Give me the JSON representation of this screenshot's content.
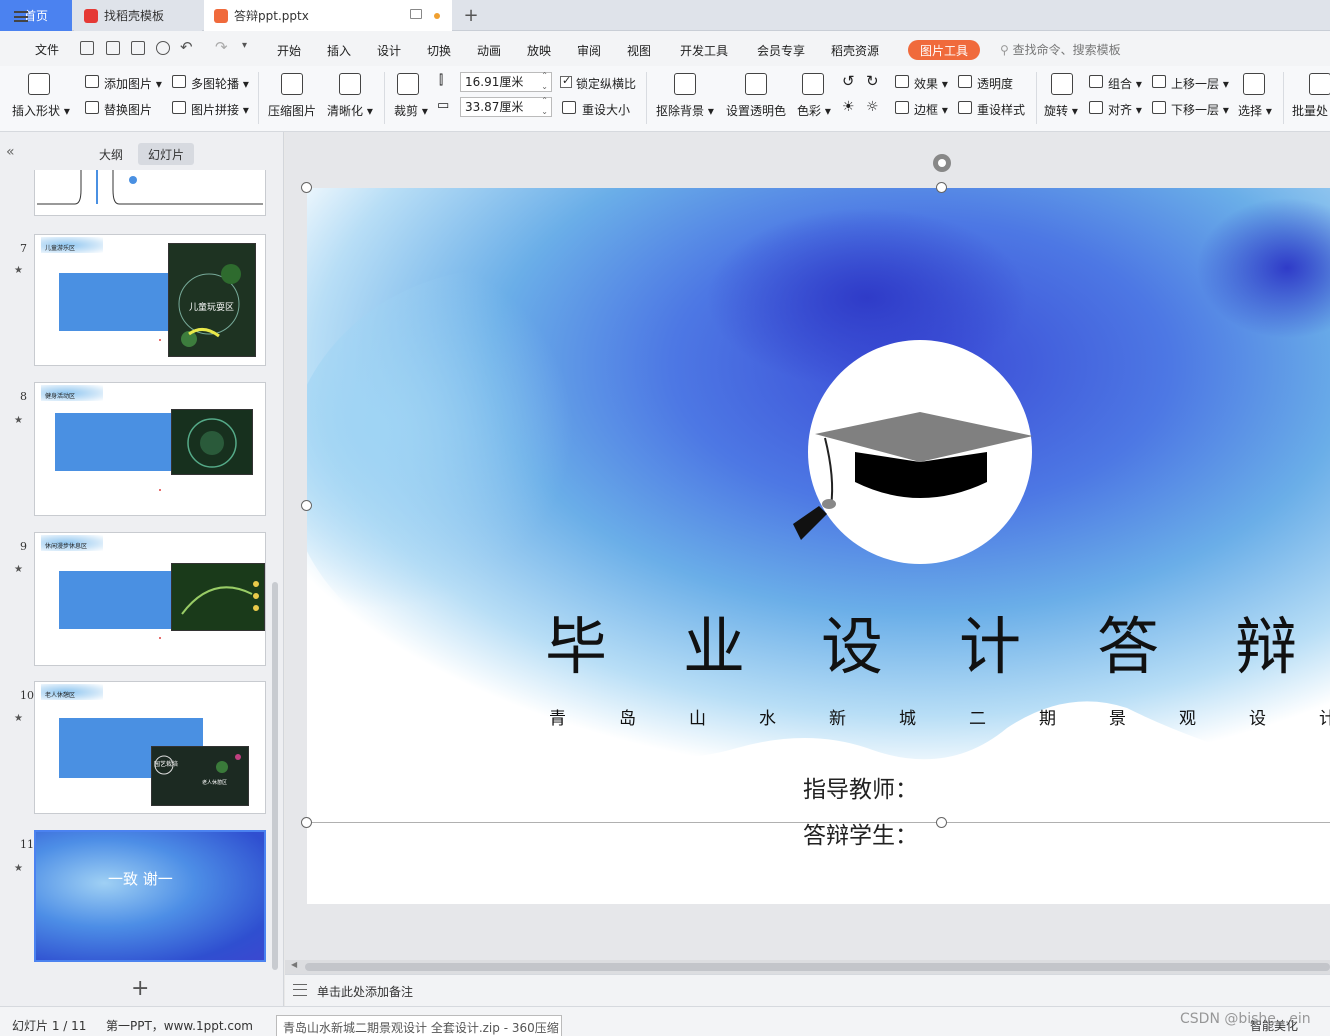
{
  "tabs": {
    "home": "首页",
    "template": "找稻壳模板",
    "file": "答辩ppt.pptx",
    "add": "+"
  },
  "menu": {
    "file": "文件",
    "items": [
      "开始",
      "插入",
      "设计",
      "切换",
      "动画",
      "放映",
      "审阅",
      "视图",
      "开发工具",
      "会员专享",
      "稻壳资源"
    ],
    "picture_tools": "图片工具",
    "search_placeholder": "查找命令、搜索模板"
  },
  "ribbon": {
    "insert_shape": "插入形状",
    "add_picture": "添加图片",
    "replace_picture": "替换图片",
    "multi_carousel": "多图轮播",
    "picture_collage": "图片拼接",
    "compress_picture": "压缩图片",
    "sharpen": "清晰化",
    "crop": "裁剪",
    "height_value": "16.91厘米",
    "width_value": "33.87厘米",
    "lock_aspect": "锁定纵横比",
    "reset_size": "重设大小",
    "remove_bg": "抠除背景",
    "set_transparent": "设置透明色",
    "color": "色彩",
    "effects": "效果",
    "border": "边框",
    "transparency": "透明度",
    "reset_style": "重设样式",
    "rotate": "旋转",
    "group": "组合",
    "align": "对齐",
    "bring_forward": "上移一层",
    "send_backward": "下移一层",
    "select": "选择",
    "batch": "批量处"
  },
  "left_panel": {
    "tab_outline": "大纲",
    "tab_slides": "幻灯片",
    "slides": [
      {
        "num": "7",
        "title": "儿童游乐区",
        "img_label": "儿童玩耍区"
      },
      {
        "num": "8",
        "title": "健身活动区"
      },
      {
        "num": "9",
        "title": "休闲漫步休息区"
      },
      {
        "num": "10",
        "title": "老人休憩区",
        "img_label": "园艺栽培",
        "img_label2": "老人休憩区"
      },
      {
        "num": "11",
        "title": "一致 谢一"
      }
    ],
    "add_slide": "+"
  },
  "slide": {
    "title": "毕业设计答辩",
    "subtitle": "青岛山水新城二期景观设计",
    "advisor_label": "指导教师：",
    "student_label": "答辩学生："
  },
  "notes": {
    "placeholder": "单击此处添加备注"
  },
  "status": {
    "slide_indicator": "幻灯片 1 / 11",
    "theme": "第一PPT，www.1ppt.com",
    "popup": "青岛山水新城二期景观设计 全套设计.zip - 360压缩",
    "smart": "智能美化",
    "watermark": "CSDN @bishe...ein"
  },
  "colors": {
    "tab_active": "#4b82f0",
    "picture_tools": "#f06a3c",
    "slide_blue": "#4a90e2",
    "deep_blue": "#3b48d0"
  }
}
